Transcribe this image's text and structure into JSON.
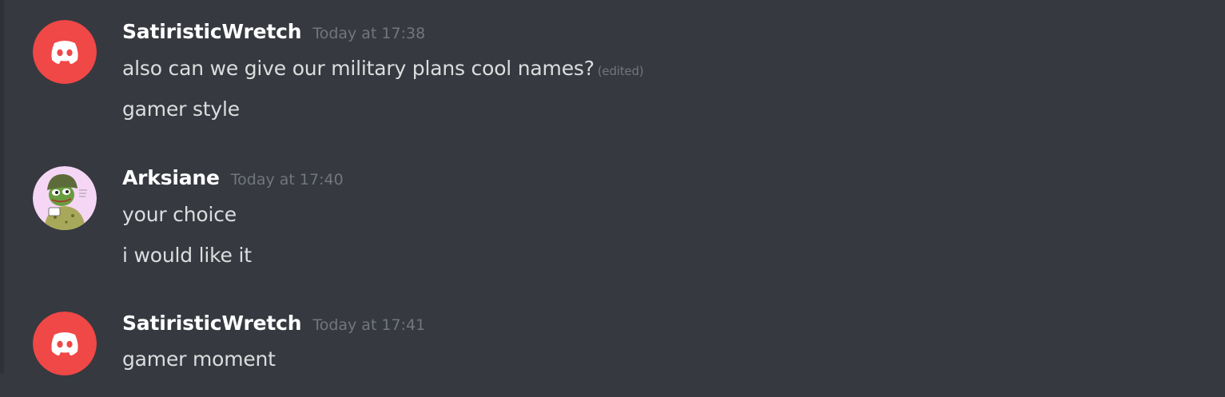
{
  "messages": [
    {
      "author": "SatiristicWretch",
      "avatar_icon": "discord-logo-icon",
      "avatar_color": "#f04747",
      "timestamp": "Today at 17:38",
      "lines": [
        {
          "text": "also can we give our military plans cool names?",
          "edited": "(edited)"
        },
        {
          "text": "gamer style"
        }
      ]
    },
    {
      "author": "Arksiane",
      "avatar_icon": "pepe-soldier-avatar-icon",
      "avatar_color": "#f5d6f5",
      "timestamp": "Today at 17:40",
      "lines": [
        {
          "text": "your choice"
        },
        {
          "text": "i would like it"
        }
      ]
    },
    {
      "author": "SatiristicWretch",
      "avatar_icon": "discord-logo-icon",
      "avatar_color": "#f04747",
      "timestamp": "Today at 17:41",
      "lines": [
        {
          "text": "gamer moment"
        }
      ]
    }
  ],
  "colors": {
    "background": "#36393f",
    "username": "#ffffff",
    "message_text": "#dcddde",
    "muted": "#72767d"
  }
}
